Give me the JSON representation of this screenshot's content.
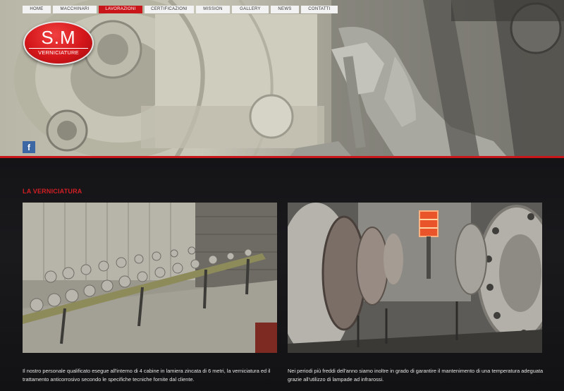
{
  "nav": {
    "items": [
      {
        "label": "HOME",
        "active": false
      },
      {
        "label": "MACCHINARI",
        "active": false
      },
      {
        "label": "LAVORAZIONI",
        "active": true
      },
      {
        "label": "CERTIFICAZIONI",
        "active": false
      },
      {
        "label": "MISSION",
        "active": false
      },
      {
        "label": "GALLERY",
        "active": false
      },
      {
        "label": "NEWS",
        "active": false
      },
      {
        "label": "CONTATTI",
        "active": false
      }
    ]
  },
  "logo": {
    "main": "S.M",
    "sub": "VERNICIATURE"
  },
  "social": {
    "facebook_glyph": "f",
    "facebook_color": "#3b67a5"
  },
  "section": {
    "title": "LA VERNICIATURA"
  },
  "captions": {
    "left": "Il nostro personale qualificato esegue all'interno di 4 cabine in lamiera zincata di 6 metri, la verniciatura ed il trattamento anticorrosivo secondo le specifiche tecniche fornite dal cliente.",
    "right": "Nei periodi più freddi dell'anno siamo inoltre in grado di garantire il mantenimento di una temperatura adeguata grazie all'utilizzo di lampade ad infrarossi."
  },
  "colors": {
    "accent": "#c8161a",
    "title": "#d21f24",
    "background": "#111114"
  }
}
